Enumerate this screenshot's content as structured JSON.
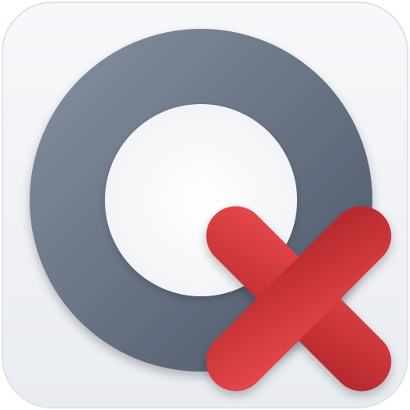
{
  "icon": {
    "name": "ring-with-red-x-app-icon",
    "tile_color_top": "#f7f8fa",
    "tile_color_bottom": "#e9ecf1",
    "tile_border_color": "#dfe3e9",
    "ring_color_light": "#8591a2",
    "ring_color_dark": "#4b5565",
    "ring_inner_color": "#f3f4f7",
    "x_color_light": "#e8484c",
    "x_color_dark": "#b3272b"
  }
}
